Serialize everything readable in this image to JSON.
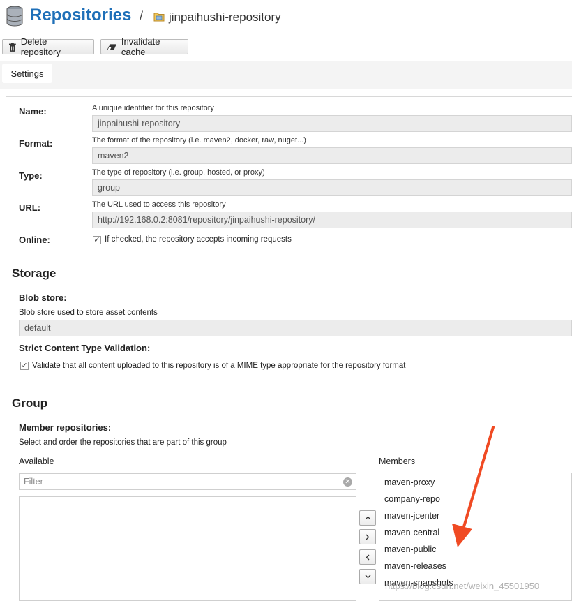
{
  "header": {
    "title": "Repositories",
    "separator": "/",
    "repo_name": "jinpaihushi-repository"
  },
  "toolbar": {
    "delete_label": "Delete repository",
    "invalidate_label": "Invalidate cache"
  },
  "tabs": [
    {
      "label": "Settings"
    }
  ],
  "fields": {
    "name": {
      "label": "Name:",
      "help": "A unique identifier for this repository",
      "value": "jinpaihushi-repository"
    },
    "format": {
      "label": "Format:",
      "help": "The format of the repository (i.e. maven2, docker, raw, nuget...)",
      "value": "maven2"
    },
    "type": {
      "label": "Type:",
      "help": "The type of repository (i.e. group, hosted, or proxy)",
      "value": "group"
    },
    "url": {
      "label": "URL:",
      "help": "The URL used to access this repository",
      "value": "http://192.168.0.2:8081/repository/jinpaihushi-repository/"
    },
    "online": {
      "label": "Online:",
      "checkbox_text": "If checked, the repository accepts incoming requests",
      "checked": true
    }
  },
  "storage": {
    "heading": "Storage",
    "blob_label": "Blob store:",
    "blob_help": "Blob store used to store asset contents",
    "blob_value": "default",
    "strict_label": "Strict Content Type Validation:",
    "strict_text": "Validate that all content uploaded to this repository is of a MIME type appropriate for the repository format",
    "strict_checked": true
  },
  "group": {
    "heading": "Group",
    "members_label": "Member repositories:",
    "members_help": "Select and order the repositories that are part of this group",
    "available_label": "Available",
    "filter_placeholder": "Filter",
    "members_col_label": "Members",
    "members": [
      "maven-proxy",
      "company-repo",
      "maven-jcenter",
      "maven-central",
      "maven-public",
      "maven-releases",
      "maven-snapshots"
    ]
  },
  "watermark": "https://blog.csdn.net/weixin_45501950",
  "colors": {
    "title_blue": "#1e6fb8",
    "annotation_arrow": "#f04a23"
  }
}
